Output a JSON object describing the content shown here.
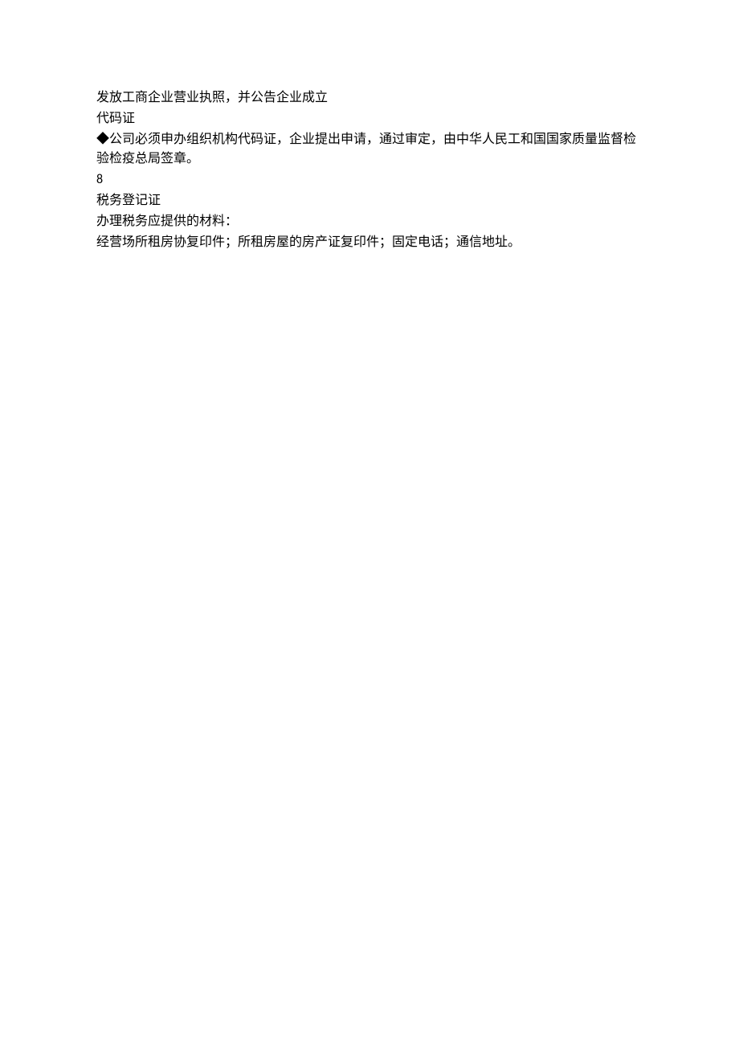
{
  "document": {
    "lines": [
      "发放工商企业营业执照，并公告企业成立",
      "代码证",
      "◆公司必须申办组织机构代码证，企业提出申请，通过审定，由中华人民工和国国家质量监督检验检疫总局签章。",
      "8",
      "税务登记证",
      "办理税务应提供的材料：",
      "经营场所租房协复印件；所租房屋的房产证复印件；固定电话；通信地址。"
    ]
  }
}
